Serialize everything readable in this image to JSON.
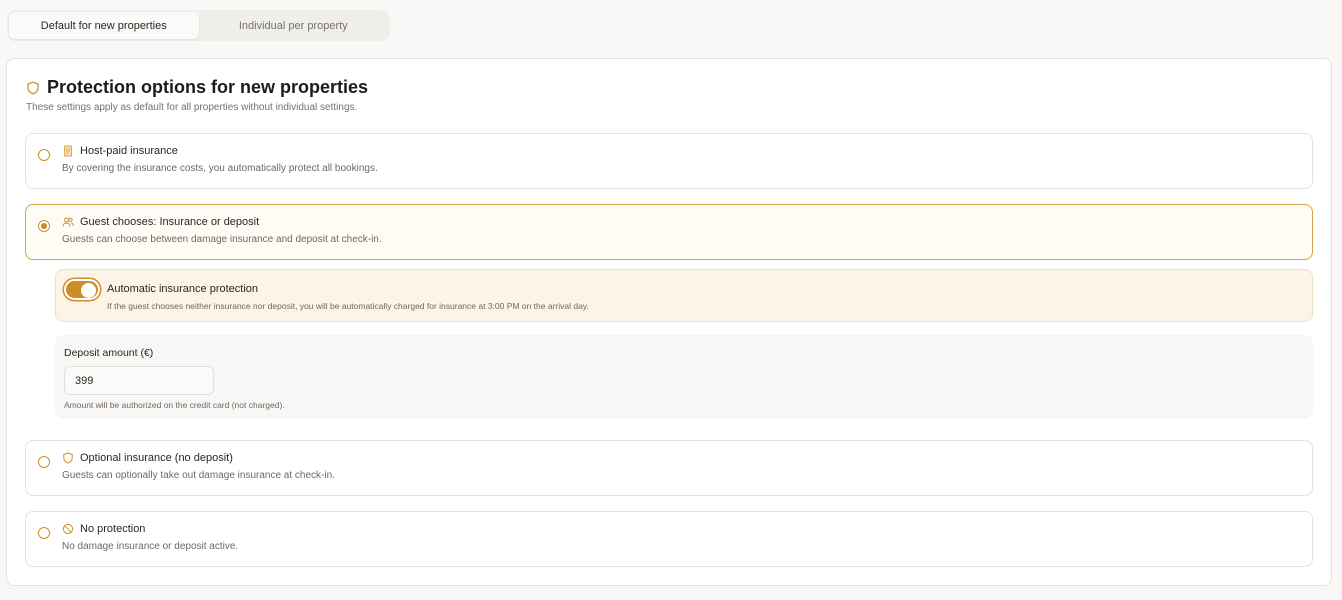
{
  "tabs": [
    {
      "label": "Default for new properties",
      "active": true
    },
    {
      "label": "Individual per property",
      "active": false
    }
  ],
  "card": {
    "icon": "shield-icon",
    "title": "Protection options for new properties",
    "subtitle": "These settings apply as default for all properties without individual settings."
  },
  "options": [
    {
      "icon": "receipt-icon",
      "label": "Host-paid insurance",
      "desc": "By covering the insurance costs, you automatically protect all bookings.",
      "selected": false
    },
    {
      "icon": "users-icon",
      "label": "Guest chooses: Insurance or deposit",
      "desc": "Guests can choose between damage insurance and deposit at check-in.",
      "selected": true
    },
    {
      "icon": "shield-icon",
      "label": "Optional insurance (no deposit)",
      "desc": "Guests can optionally take out damage insurance at check-in.",
      "selected": false
    },
    {
      "icon": "ban-icon",
      "label": "No protection",
      "desc": "No damage insurance or deposit active.",
      "selected": false
    }
  ],
  "auto_protection": {
    "enabled": true,
    "title": "Automatic insurance protection",
    "desc": "If the guest chooses neither insurance nor deposit, you will be automatically charged for insurance at 3:00 PM on the arrival day."
  },
  "deposit": {
    "label": "Deposit amount (€)",
    "value": "399",
    "note": "Amount will be authorized on the credit card (not charged)."
  },
  "colors": {
    "accent": "#cc8e2a",
    "selected_border": "#d6a34a",
    "selected_bg": "#fffcf6",
    "auto_bg": "#fdf4e8"
  }
}
